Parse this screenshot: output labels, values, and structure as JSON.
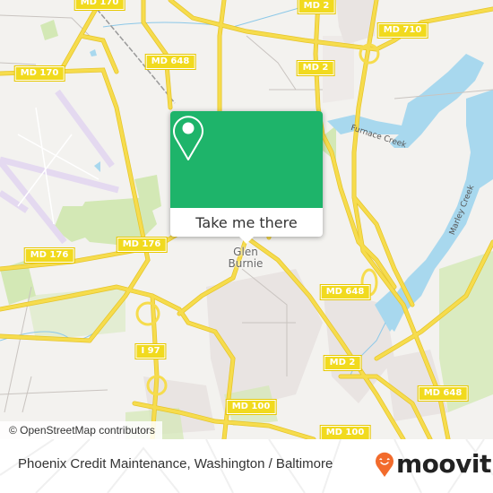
{
  "map": {
    "road_labels": [
      {
        "id": "md170-top",
        "text": "MD 170"
      },
      {
        "id": "md170-left",
        "text": "MD 170"
      },
      {
        "id": "md648-top",
        "text": "MD 648"
      },
      {
        "id": "md2-top",
        "text": "MD 2"
      },
      {
        "id": "md2-mid",
        "text": "MD 2"
      },
      {
        "id": "md710",
        "text": "MD 710"
      },
      {
        "id": "md176-left",
        "text": "MD 176"
      },
      {
        "id": "md176-mid",
        "text": "MD 176"
      },
      {
        "id": "i97",
        "text": "I 97"
      },
      {
        "id": "md648-mid",
        "text": "MD 648"
      },
      {
        "id": "md2-low",
        "text": "MD 2"
      },
      {
        "id": "md648-low",
        "text": "MD 648"
      },
      {
        "id": "md100-left",
        "text": "MD 100"
      },
      {
        "id": "md100-right",
        "text": "MD 100"
      }
    ],
    "place_label": "Glen\nBurnie",
    "water_labels": [
      "Furnace Creek",
      "Marley Creek"
    ],
    "attribution": "© OpenStreetMap contributors",
    "colors": {
      "land": "#f3f2ef",
      "road": "#f6dc4d",
      "water": "#a8d8ee",
      "park": "#d3e8b5",
      "urban": "#e6e0df",
      "runway": "#e4d9f0"
    }
  },
  "popup": {
    "icon": "map-pin-icon",
    "action_label": "Take me there",
    "accent": "#1eb46a"
  },
  "footer": {
    "title": "Phoenix Credit Maintenance, Washington / Baltimore",
    "brand": "moovit",
    "brand_color": "#f26b2c"
  }
}
